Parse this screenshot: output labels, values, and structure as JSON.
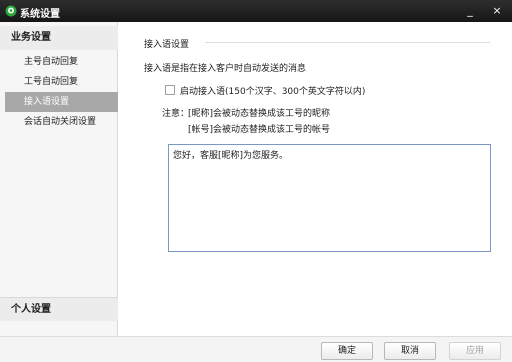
{
  "window": {
    "title": "系统设置",
    "minimize_glyph": "_",
    "close_glyph": "×",
    "app_icon": "chat-bubble-icon",
    "accent_color": "#2aa63a"
  },
  "sidebar": {
    "business_header": "业务设置",
    "items": [
      {
        "label": "主号自动回复",
        "active": false
      },
      {
        "label": "工号自动回复",
        "active": false
      },
      {
        "label": "接入语设置",
        "active": true
      },
      {
        "label": "会话自动关闭设置",
        "active": false
      }
    ],
    "personal_header": "个人设置"
  },
  "main": {
    "group_title": "接入语设置",
    "description": "接入语是指在接入客户时自动发送的消息",
    "enable_checkbox": {
      "label": "启动接入语(150个汉字、300个英文字符以内)",
      "checked": false
    },
    "note_prefix": "注意：",
    "note_line1": "[昵称]会被动态替换成该工号的昵称",
    "note_line2": "[帐号]会被动态替换成该工号的帐号",
    "message_text": "您好，客服[昵称]为您服务。"
  },
  "footer": {
    "ok_label": "确定",
    "cancel_label": "取消",
    "apply_label": "应用"
  }
}
